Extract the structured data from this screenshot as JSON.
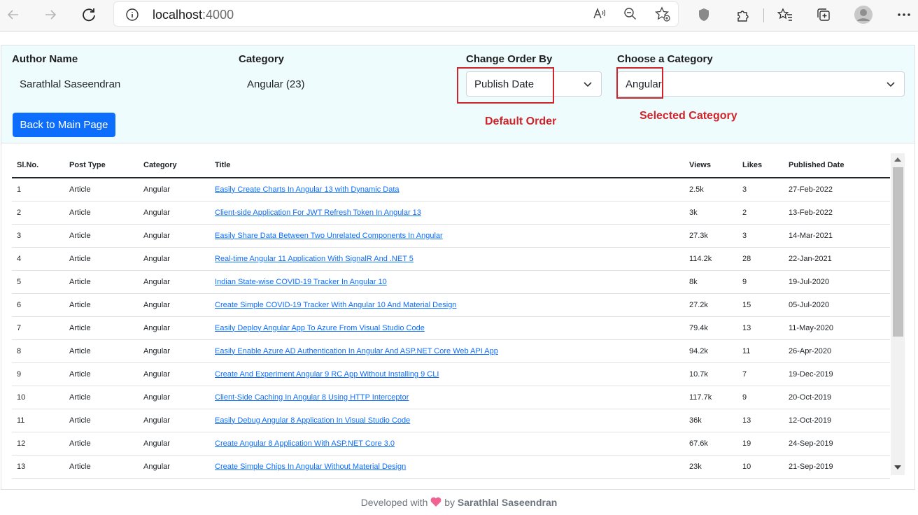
{
  "browser": {
    "url_host": "localhost",
    "url_port": ":4000"
  },
  "header": {
    "author_label": "Author Name",
    "author_value": "Sarathlal Saseendran",
    "category_label": "Category",
    "category_value": "Angular (23)",
    "order_label": "Change Order By",
    "order_value": "Publish Date",
    "choose_label": "Choose a Category",
    "choose_value": "Angular",
    "back_button": "Back to Main Page",
    "annotation_default": "Default Order",
    "annotation_selected": "Selected Category"
  },
  "table": {
    "headers": [
      "Sl.No.",
      "Post Type",
      "Category",
      "Title",
      "Views",
      "Likes",
      "Published Date"
    ],
    "rows": [
      {
        "no": "1",
        "type": "Article",
        "cat": "Angular",
        "title": "Easily Create Charts In Angular 13 with Dynamic Data",
        "views": "2.5k",
        "likes": "3",
        "date": "27-Feb-2022"
      },
      {
        "no": "2",
        "type": "Article",
        "cat": "Angular",
        "title": "Client-side Application For JWT Refresh Token In Angular 13",
        "views": "3k",
        "likes": "2",
        "date": "13-Feb-2022"
      },
      {
        "no": "3",
        "type": "Article",
        "cat": "Angular",
        "title": "Easily Share Data Between Two Unrelated Components In Angular",
        "views": "27.3k",
        "likes": "3",
        "date": "14-Mar-2021"
      },
      {
        "no": "4",
        "type": "Article",
        "cat": "Angular",
        "title": "Real-time Angular 11 Application With SignalR And .NET 5",
        "views": "114.2k",
        "likes": "28",
        "date": "22-Jan-2021"
      },
      {
        "no": "5",
        "type": "Article",
        "cat": "Angular",
        "title": "Indian State-wise COVID-19 Tracker In Angular 10",
        "views": "8k",
        "likes": "9",
        "date": "19-Jul-2020"
      },
      {
        "no": "6",
        "type": "Article",
        "cat": "Angular",
        "title": "Create Simple COVID-19 Tracker With Angular 10 And Material Design",
        "views": "27.2k",
        "likes": "15",
        "date": "05-Jul-2020"
      },
      {
        "no": "7",
        "type": "Article",
        "cat": "Angular",
        "title": "Easily Deploy Angular App To Azure From Visual Studio Code",
        "views": "79.4k",
        "likes": "13",
        "date": "11-May-2020"
      },
      {
        "no": "8",
        "type": "Article",
        "cat": "Angular",
        "title": "Easily Enable Azure AD Authentication In Angular And ASP.NET Core Web API App",
        "views": "94.2k",
        "likes": "11",
        "date": "26-Apr-2020"
      },
      {
        "no": "9",
        "type": "Article",
        "cat": "Angular",
        "title": "Create And Experiment Angular 9 RC App Without Installing 9 CLI",
        "views": "10.7k",
        "likes": "7",
        "date": "19-Dec-2019"
      },
      {
        "no": "10",
        "type": "Article",
        "cat": "Angular",
        "title": "Client-Side Caching In Angular 8 Using HTTP Interceptor",
        "views": "117.7k",
        "likes": "9",
        "date": "20-Oct-2019"
      },
      {
        "no": "11",
        "type": "Article",
        "cat": "Angular",
        "title": "Easily Debug Angular 8 Application In Visual Studio Code",
        "views": "36k",
        "likes": "13",
        "date": "12-Oct-2019"
      },
      {
        "no": "12",
        "type": "Article",
        "cat": "Angular",
        "title": "Create Angular 8 Application With ASP.NET Core 3.0",
        "views": "67.6k",
        "likes": "19",
        "date": "24-Sep-2019"
      },
      {
        "no": "13",
        "type": "Article",
        "cat": "Angular",
        "title": "Create Simple Chips In Angular Without Material Design",
        "views": "23k",
        "likes": "10",
        "date": "21-Sep-2019"
      }
    ]
  },
  "footer": {
    "prefix": "Developed with",
    "by": "by",
    "author": "Sarathlal Saseendran"
  },
  "colors": {
    "accent": "#0d6efd",
    "annotation": "#d0232a",
    "heart": "#f06292",
    "panel_bg": "#eefcfe"
  },
  "icons": [
    "back-arrow-icon",
    "forward-arrow-icon",
    "refresh-icon",
    "info-icon",
    "read-aloud-icon",
    "zoom-out-icon",
    "favorite-add-icon",
    "shield-icon",
    "extensions-icon",
    "favorites-icon",
    "collections-icon",
    "profile-icon",
    "more-icon",
    "chevron-down-icon",
    "heart-icon"
  ]
}
